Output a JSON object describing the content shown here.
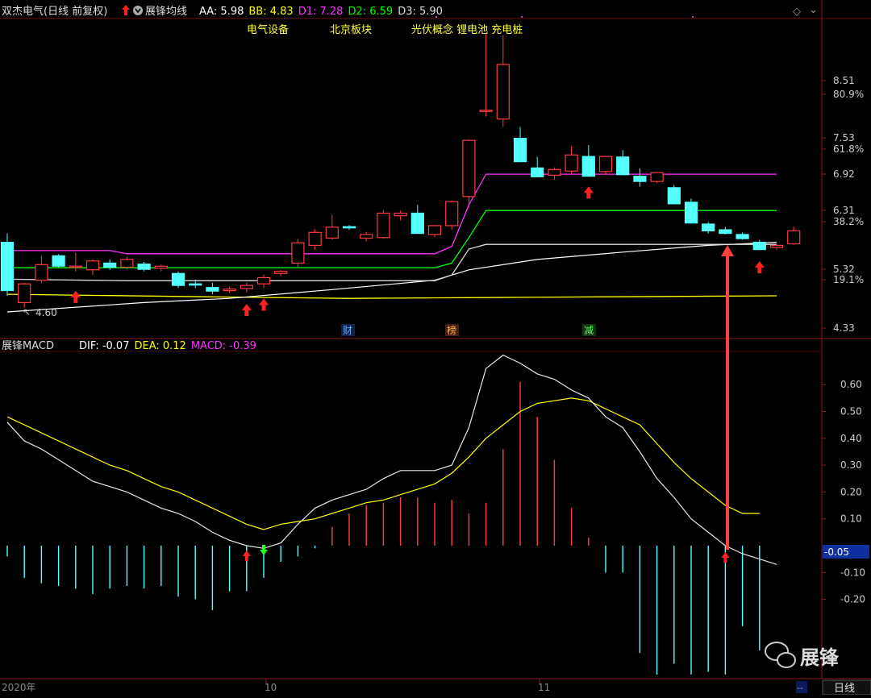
{
  "header": {
    "stock": "双杰电气(日线 前复权)",
    "indicator": "展锋均线",
    "items": [
      {
        "label": "AA: 5.98",
        "color": "#ffffff"
      },
      {
        "label": "BB: 4.83",
        "color": "#ffff00"
      },
      {
        "label": "D1: 7.28",
        "color": "#ff33ff"
      },
      {
        "label": "D2: 6.59",
        "color": "#00ff00"
      },
      {
        "label": "D3: 5.90",
        "color": "#dddddd"
      }
    ],
    "diamond": "◇",
    "ribbon": "⌄"
  },
  "concepts": [
    "电气设备",
    "北京板块",
    "光伏概念 锂电池 充电桩"
  ],
  "annotations": {
    "low_price": "4.60",
    "cai": "财",
    "bang": "榜",
    "jian": "减"
  },
  "price_axis": {
    "labels": [
      {
        "t": "8.51",
        "c": "#cccccc"
      },
      {
        "t": "80.9%",
        "c": "#cccccc"
      },
      {
        "t": "7.53",
        "c": "#cccccc"
      },
      {
        "t": "61.8%",
        "c": "#cccccc"
      },
      {
        "t": "6.92",
        "c": "#cccccc"
      },
      {
        "t": "6.31",
        "c": "#cccccc"
      },
      {
        "t": "38.2%",
        "c": "#cccccc"
      },
      {
        "t": "5.32",
        "c": "#cccccc"
      },
      {
        "t": "19.1%",
        "c": "#cccccc"
      },
      {
        "t": "4.33",
        "c": "#cccccc"
      }
    ]
  },
  "macd_header": {
    "name": "展锋MACD",
    "dif": "DIF: -0.07",
    "dea": "DEA: 0.12",
    "macd": "MACD: -0.39",
    "dif_color": "#ffffff",
    "dea_color": "#ffff00",
    "macd_color": "#ff33ff"
  },
  "macd_axis": {
    "labels": [
      "0.60",
      "0.50",
      "0.40",
      "0.30",
      "0.20",
      "0.10",
      "-0.10",
      "-0.20"
    ],
    "current": "-0.05"
  },
  "date_axis": {
    "labels": [
      "2020年",
      "10",
      "11"
    ],
    "scroll_btn": "--",
    "period": "日线"
  },
  "watermark": {
    "text": "展锋"
  },
  "colors": {
    "up": "#ff3b3b",
    "down": "#54ffff",
    "d1": "#ff33ff",
    "d2": "#00ff00",
    "d3": "#dddddd",
    "aa": "#ffffff",
    "bb": "#ffff00"
  },
  "chart_data": {
    "type": "candlestick",
    "ohlc": [
      [
        5.98,
        6.15,
        4.95,
        5.05
      ],
      [
        4.82,
        5.2,
        4.72,
        5.18
      ],
      [
        5.25,
        5.72,
        5.2,
        5.55
      ],
      [
        5.72,
        5.75,
        5.5,
        5.52
      ],
      [
        5.5,
        5.78,
        5.42,
        5.52
      ],
      [
        5.45,
        5.65,
        5.35,
        5.62
      ],
      [
        5.58,
        5.65,
        5.45,
        5.5
      ],
      [
        5.5,
        5.7,
        5.46,
        5.65
      ],
      [
        5.56,
        5.6,
        5.42,
        5.46
      ],
      [
        5.48,
        5.55,
        5.42,
        5.52
      ],
      [
        5.38,
        5.42,
        5.1,
        5.15
      ],
      [
        5.18,
        5.26,
        5.1,
        5.16
      ],
      [
        5.11,
        5.2,
        4.98,
        5.04
      ],
      [
        5.05,
        5.12,
        5.0,
        5.08
      ],
      [
        5.09,
        5.2,
        5.02,
        5.15
      ],
      [
        5.18,
        5.36,
        5.1,
        5.3
      ],
      [
        5.38,
        5.45,
        5.33,
        5.42
      ],
      [
        5.58,
        6.04,
        5.48,
        5.97
      ],
      [
        5.92,
        6.23,
        5.84,
        6.17
      ],
      [
        6.06,
        6.51,
        6.03,
        6.27
      ],
      [
        6.28,
        6.31,
        6.22,
        6.27
      ],
      [
        6.06,
        6.18,
        6.0,
        6.13
      ],
      [
        6.07,
        6.6,
        6.05,
        6.54
      ],
      [
        6.49,
        6.59,
        6.4,
        6.54
      ],
      [
        6.54,
        6.7,
        6.15,
        6.15
      ],
      [
        6.13,
        6.28,
        6.08,
        6.3
      ],
      [
        6.3,
        6.78,
        6.22,
        6.76
      ],
      [
        6.86,
        7.96,
        6.65,
        7.94
      ],
      [
        8.52,
        9.98,
        8.4,
        8.52
      ],
      [
        8.35,
        9.96,
        8.2,
        9.4
      ],
      [
        7.98,
        8.2,
        7.55,
        7.53
      ],
      [
        7.41,
        7.62,
        7.23,
        7.24
      ],
      [
        7.27,
        7.42,
        7.18,
        7.38
      ],
      [
        7.35,
        7.83,
        7.3,
        7.66
      ],
      [
        7.63,
        7.85,
        7.45,
        7.25
      ],
      [
        7.34,
        7.63,
        7.28,
        7.63
      ],
      [
        7.62,
        7.75,
        7.38,
        7.28
      ],
      [
        7.25,
        7.4,
        7.05,
        7.15
      ],
      [
        7.15,
        7.3,
        7.12,
        7.32
      ],
      [
        7.03,
        7.08,
        6.72,
        6.72
      ],
      [
        6.75,
        6.82,
        6.35,
        6.35
      ],
      [
        6.33,
        6.37,
        6.15,
        6.2
      ],
      [
        6.22,
        6.27,
        6.13,
        6.15
      ],
      [
        6.13,
        6.17,
        6.03,
        6.05
      ],
      [
        5.98,
        6.03,
        5.83,
        5.84
      ],
      [
        5.88,
        5.95,
        5.84,
        5.92
      ],
      [
        5.95,
        6.28,
        5.93,
        6.2
      ]
    ],
    "d1": [
      [
        0,
        5.82
      ],
      [
        6,
        5.82
      ],
      [
        7,
        5.76
      ],
      [
        25,
        5.76
      ],
      [
        26,
        5.9
      ],
      [
        27,
        6.7
      ],
      [
        28,
        7.29
      ],
      [
        45,
        7.29
      ]
    ],
    "d2": [
      [
        0,
        5.49
      ],
      [
        25,
        5.49
      ],
      [
        26,
        5.58
      ],
      [
        27,
        6.07
      ],
      [
        28,
        6.59
      ],
      [
        45,
        6.59
      ]
    ],
    "d3": [
      [
        0,
        5.27
      ],
      [
        7,
        5.24
      ],
      [
        25,
        5.24
      ],
      [
        26,
        5.35
      ],
      [
        27,
        5.85
      ],
      [
        28,
        5.94
      ],
      [
        45,
        5.94
      ]
    ],
    "aa": [
      [
        0,
        4.64
      ],
      [
        8,
        4.82
      ],
      [
        13,
        4.9
      ],
      [
        19,
        5.07
      ],
      [
        25,
        5.25
      ],
      [
        27,
        5.45
      ],
      [
        31,
        5.65
      ],
      [
        36,
        5.79
      ],
      [
        41,
        5.92
      ],
      [
        45,
        5.98
      ]
    ],
    "bb": [
      [
        0,
        4.98
      ],
      [
        12,
        4.93
      ],
      [
        20,
        4.9
      ],
      [
        30,
        4.92
      ],
      [
        45,
        4.95
      ]
    ],
    "fib_levels": [
      "80.9%",
      "61.8%",
      "38.2%",
      "19.1%"
    ],
    "macd": {
      "dif": [
        0.46,
        0.39,
        0.36,
        0.32,
        0.28,
        0.24,
        0.22,
        0.2,
        0.17,
        0.14,
        0.12,
        0.09,
        0.05,
        0.02,
        0.0,
        -0.01,
        0.01,
        0.08,
        0.14,
        0.17,
        0.19,
        0.21,
        0.25,
        0.28,
        0.28,
        0.28,
        0.3,
        0.44,
        0.66,
        0.71,
        0.68,
        0.64,
        0.62,
        0.58,
        0.55,
        0.48,
        0.44,
        0.35,
        0.25,
        0.18,
        0.1,
        0.05,
        0.0,
        -0.03,
        -0.05,
        -0.07
      ],
      "dea": [
        0.48,
        0.45,
        0.42,
        0.39,
        0.36,
        0.33,
        0.3,
        0.28,
        0.25,
        0.22,
        0.2,
        0.17,
        0.14,
        0.11,
        0.08,
        0.06,
        0.08,
        0.09,
        0.1,
        0.12,
        0.14,
        0.16,
        0.17,
        0.19,
        0.21,
        0.23,
        0.27,
        0.33,
        0.4,
        0.45,
        0.5,
        0.53,
        0.54,
        0.55,
        0.54,
        0.51,
        0.48,
        0.45,
        0.38,
        0.31,
        0.25,
        0.2,
        0.15,
        0.12,
        0.12
      ],
      "hist": [
        -0.04,
        -0.12,
        -0.14,
        -0.15,
        -0.16,
        -0.18,
        -0.16,
        -0.15,
        -0.16,
        -0.15,
        -0.19,
        -0.2,
        -0.24,
        -0.17,
        -0.17,
        -0.12,
        -0.06,
        -0.04,
        -0.01,
        0.07,
        0.12,
        0.15,
        0.16,
        0.18,
        0.18,
        0.16,
        0.17,
        0.12,
        0.16,
        0.36,
        0.61,
        0.48,
        0.32,
        0.14,
        0.03,
        -0.1,
        -0.1,
        -0.4,
        -0.48,
        -0.44,
        -0.48,
        -0.47,
        -0.48,
        -0.3,
        -0.39
      ]
    }
  }
}
